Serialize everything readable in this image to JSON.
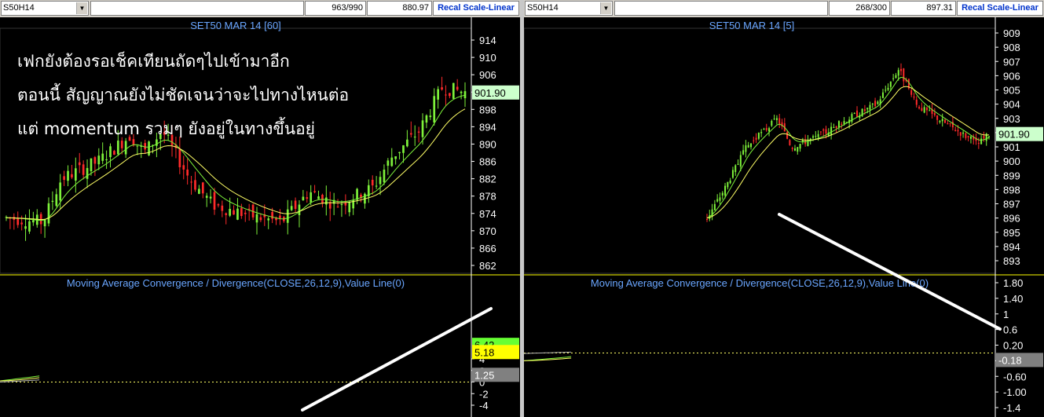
{
  "left": {
    "toolbar": {
      "symbol": "S50H14",
      "count": "963/990",
      "price": "880.97",
      "scale_button": "Recal Scale-Linear"
    },
    "title": "SET50 MAR 14   [60]",
    "price_axis": [
      "914",
      "910",
      "906",
      "902",
      "898",
      "894",
      "890",
      "886",
      "882",
      "878",
      "874",
      "870",
      "866",
      "862"
    ],
    "last_price": "901.90",
    "macd_title": "Moving Average Convergence / Divergence(CLOSE,26,12,9),Value Line(0)",
    "macd_axis": [
      "4",
      "2",
      "0",
      "-2",
      "-4"
    ],
    "macd_badges": [
      "6.42",
      "5.18",
      "1.25"
    ],
    "annotation": [
      "เฟกยังต้องรอเช็คเทียนถัดๆไปเข้ามาอีก",
      "ตอนนี้ สัญญาณยังไม่ชัดเจนว่าจะไปทางไหนต่อ",
      "แต่ momentum รวมๆ ยังอยู่ในทางขึ้นอยู่"
    ]
  },
  "right": {
    "toolbar": {
      "symbol": "S50H14",
      "count": "268/300",
      "price": "897.31",
      "scale_button": "Recal Scale-Linear"
    },
    "title": "SET50 MAR 14   [5]",
    "price_axis": [
      "909",
      "908",
      "907",
      "906",
      "905",
      "904",
      "903",
      "902",
      "901",
      "900",
      "899",
      "898",
      "897",
      "896",
      "895",
      "894",
      "893"
    ],
    "last_price": "901.90",
    "macd_title": "Moving Average Convergence / Divergence(CLOSE,26,12,9),Value Line(0)",
    "macd_axis": [
      "1.80",
      "1.40",
      "1",
      "0.6",
      "0.20",
      "-0.20",
      "-0.60",
      "-1.00",
      "-1.4"
    ],
    "macd_badges": [
      "-0.18"
    ]
  },
  "colors": {
    "up": "#7ef23a",
    "down": "#ff2a2a",
    "fast_ma": "#7ef23a",
    "slow_ma": "#ffff66",
    "signal": "#ffff66",
    "hist": "#b4b4b4",
    "trend": "#ffffff",
    "title": "#6aa6ff",
    "badge_green": "#66ff33",
    "badge_yellow": "#ffff00",
    "badge_gray": "#808080"
  }
}
